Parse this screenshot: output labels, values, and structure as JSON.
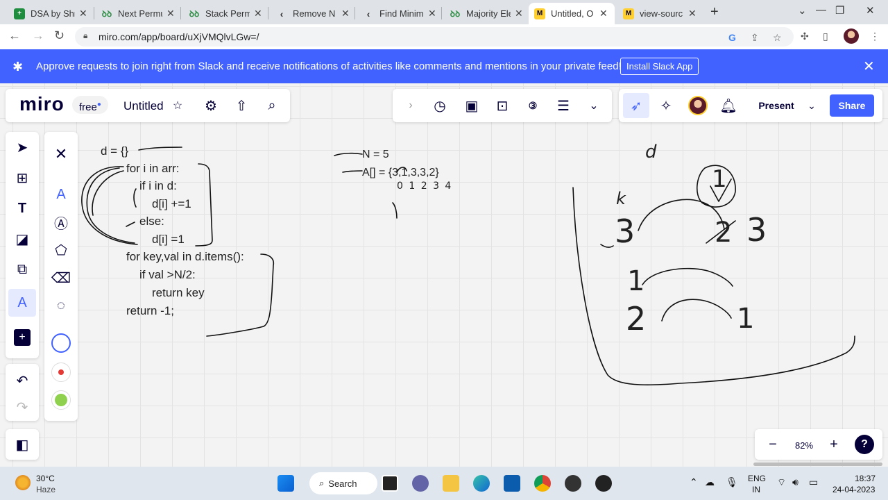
{
  "browser": {
    "tabs": [
      {
        "title": "DSA by Shr",
        "icon": "sheets-icon",
        "color": "#1e8e3e",
        "active": false
      },
      {
        "title": "Next Permu",
        "icon": "gfg-icon",
        "color": "#2f8d46",
        "active": false
      },
      {
        "title": "Stack Perm",
        "icon": "gfg-icon",
        "color": "#2f8d46",
        "active": false
      },
      {
        "title": "Remove N",
        "icon": "leetcode-icon",
        "color": "#ffa116",
        "active": false
      },
      {
        "title": "Find Minim",
        "icon": "leetcode-icon",
        "color": "#ffa116",
        "active": false
      },
      {
        "title": "Majority Ele",
        "icon": "gfg-icon",
        "color": "#2f8d46",
        "active": false
      },
      {
        "title": "Untitled, O",
        "icon": "miro-icon",
        "color": "#ffd02f",
        "active": true
      },
      {
        "title": "view-sourc",
        "icon": "miro-icon",
        "color": "#ffd02f",
        "active": false
      }
    ],
    "url": "miro.com/app/board/uXjVMQlvLGw=/"
  },
  "banner": {
    "message": "Approve requests to join right from Slack and receive notifications of activities like comments and mentions in your private feed!",
    "button": "Install Slack App"
  },
  "miro": {
    "logo": "miro",
    "plan": "free",
    "board_title": "Untitled",
    "present": "Present",
    "share": "Share",
    "zoom": "82%"
  },
  "board": {
    "code_lines": [
      "d = {}",
      "for i in arr:",
      "if i in d:",
      "d[i] +=1",
      "else:",
      "d[i] =1",
      "for key,val in d.items():",
      "if val >N/2:",
      "return key",
      "return -1;"
    ],
    "notes": [
      "N = 5",
      "A[] = {3,1,3,3,2}",
      "0 1 2 3 4"
    ],
    "scribbles": [
      "d",
      "k",
      "3",
      "2",
      "3",
      "1",
      "1",
      "2",
      "1"
    ]
  },
  "colors": {
    "accent": "#4262ff",
    "red_swatch": "#e53935",
    "green_swatch": "#8fd14f"
  },
  "taskbar": {
    "weather_temp": "30°C",
    "weather_desc": "Haze",
    "search": "Search",
    "lang1": "ENG",
    "lang2": "IN",
    "time": "18:37",
    "date": "24-04-2023"
  }
}
